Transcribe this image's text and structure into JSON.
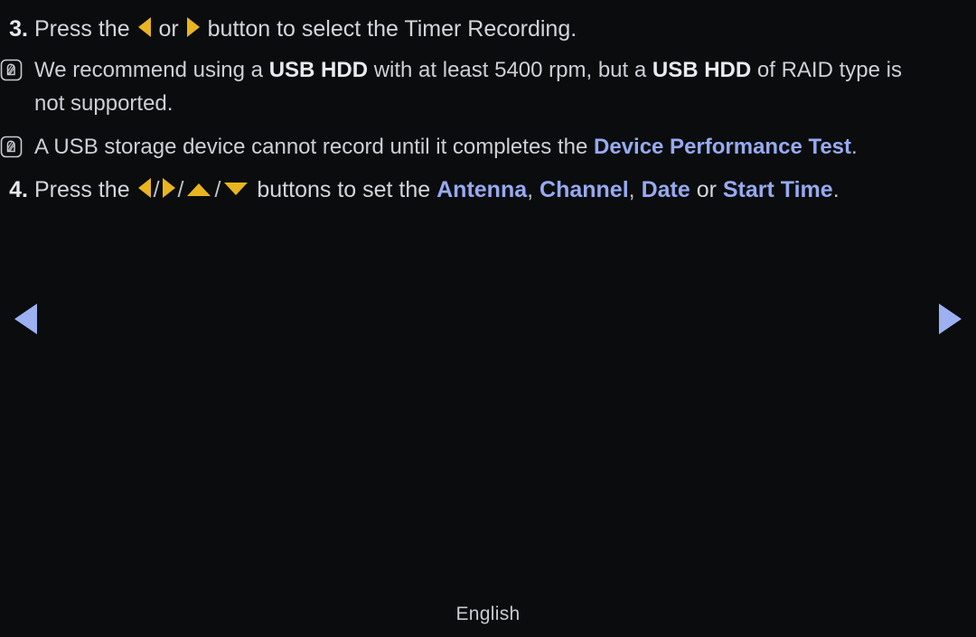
{
  "page": {
    "background_color": "#0a0c0e",
    "text_color": "#d3d6d9",
    "highlight_color": "#97aaf0",
    "arrow_color": "#e9b41f",
    "nav_arrow_color": "#9db0f2",
    "language_label": "English"
  },
  "steps": [
    {
      "number": "3.",
      "segments": [
        {
          "type": "text",
          "value": "Press the "
        },
        {
          "type": "icon",
          "icon": "arrow-left-triangle-icon"
        },
        {
          "type": "text",
          "value": " or "
        },
        {
          "type": "icon",
          "icon": "arrow-right-triangle-icon"
        },
        {
          "type": "text",
          "value": " button to select the Timer Recording."
        }
      ],
      "plain": "Press the ◀ or ▶ button to select the Timer Recording."
    },
    {
      "number": "4.",
      "segments": [
        {
          "type": "text",
          "value": "Press the "
        },
        {
          "type": "icon",
          "icon": "arrow-left-triangle-icon"
        },
        {
          "type": "sep",
          "value": "/"
        },
        {
          "type": "icon",
          "icon": "arrow-right-triangle-icon"
        },
        {
          "type": "sep",
          "value": "/"
        },
        {
          "type": "icon",
          "icon": "arrow-up-triangle-icon"
        },
        {
          "type": "sep",
          "value": "/"
        },
        {
          "type": "icon",
          "icon": "arrow-down-triangle-icon"
        },
        {
          "type": "text",
          "value": " buttons to set the "
        },
        {
          "type": "highlight",
          "value": "Antenna"
        },
        {
          "type": "punct",
          "value": ", "
        },
        {
          "type": "highlight",
          "value": "Channel"
        },
        {
          "type": "punct",
          "value": ", "
        },
        {
          "type": "highlight",
          "value": "Date"
        },
        {
          "type": "text",
          "value": " or "
        },
        {
          "type": "highlight",
          "value": "Start Time"
        },
        {
          "type": "punct",
          "value": "."
        }
      ],
      "plain": "Press the ◀ / ▶ / ▲ / ▼ buttons to set the Antenna, Channel, Date or Start Time."
    }
  ],
  "notes": [
    {
      "icon": "note-pencil-icon",
      "segments": [
        {
          "type": "text",
          "value": "We recommend using a "
        },
        {
          "type": "bold",
          "value": "USB HDD"
        },
        {
          "type": "text",
          "value": " with at least 5400 rpm, but a "
        },
        {
          "type": "bold",
          "value": "USB HDD"
        },
        {
          "type": "text",
          "value": " of RAID type is not supported."
        }
      ],
      "plain": "We recommend using a USB HDD with at least 5400 rpm, but a USB HDD of RAID type is not supported."
    },
    {
      "icon": "note-pencil-icon",
      "segments": [
        {
          "type": "text",
          "value": "A USB storage device cannot record until it completes the "
        },
        {
          "type": "highlight",
          "value": "Device Performance Test"
        },
        {
          "type": "punct",
          "value": "."
        }
      ],
      "plain": "A USB storage device cannot record until it completes the Device Performance Test."
    }
  ],
  "navigation": {
    "previous_label": "Previous page",
    "next_label": "Next page"
  },
  "text_fragments": {
    "step3_a": "Press the ",
    "step3_b": " or ",
    "step3_c": " button to select the Timer Recording.",
    "note1_a": "We recommend using a ",
    "note1_usb1": "USB HDD",
    "note1_b": " with at least 5400 rpm, but a ",
    "note1_usb2": "USB HDD",
    "note1_c": " of RAID type is not supported.",
    "note2_a": "A USB storage device cannot record until it completes the ",
    "note2_hl": "Device Performance Test",
    "note2_dot": ".",
    "step4_a": "Press the ",
    "step4_b": " buttons to set the ",
    "step4_antenna": "Antenna",
    "step4_comma1": ", ",
    "step4_channel": "Channel",
    "step4_comma2": ", ",
    "step4_date": "Date",
    "step4_or": " or ",
    "step4_starttime": "Start Time",
    "step4_dot": ".",
    "slash": "/",
    "num3": "3.",
    "num4": "4.",
    "language": "English"
  }
}
